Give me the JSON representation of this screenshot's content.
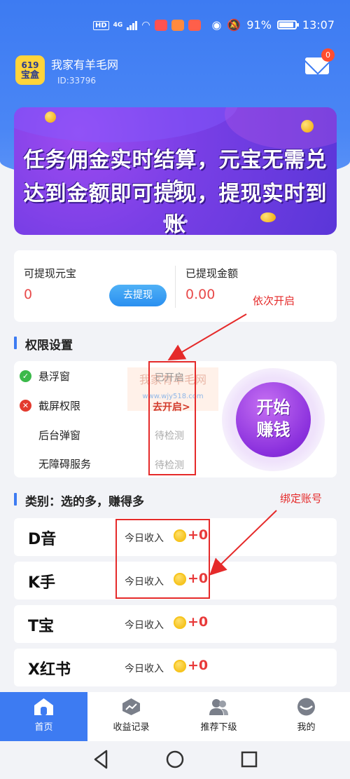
{
  "status_bar": {
    "net": "HD",
    "net2": "4G",
    "battery": "91%",
    "time": "13:07"
  },
  "header": {
    "logo_top": "619",
    "logo_bottom": "宝盒",
    "user_name": "我家有羊毛网",
    "user_id": "ID:33796",
    "message_count": "0"
  },
  "banner": {
    "line1": "任务佣金实时结算，元宝无需兑换",
    "line2": "达到金额即可提现，提现实时到账"
  },
  "withdraw": {
    "available_label": "可提现元宝",
    "available_value": "0",
    "withdraw_button": "去提现",
    "withdrawn_label": "已提现金额",
    "withdrawn_value": "0.00"
  },
  "permissions": {
    "title": "权限设置",
    "items": [
      {
        "name": "悬浮窗",
        "status": "已开启",
        "state": "ok"
      },
      {
        "name": "截屏权限",
        "status": "去开启>",
        "state": "error"
      },
      {
        "name": "后台弹窗",
        "status": "待检测",
        "state": "pending"
      },
      {
        "name": "无障碍服务",
        "status": "待检测",
        "state": "pending"
      }
    ],
    "start_button": {
      "line1": "开始",
      "line2": "赚钱"
    },
    "watermark": {
      "line1": "我家有羊毛网",
      "line2": "www.wjy518.com"
    }
  },
  "annotations": {
    "open_in_order": "依次开启",
    "bind_account": "绑定账号"
  },
  "categories": {
    "title": "类别：选的多，赚得多",
    "items": [
      {
        "name": "D音",
        "income_label": "今日收入",
        "income": "+0"
      },
      {
        "name": "K手",
        "income_label": "今日收入",
        "income": "+0"
      },
      {
        "name": "T宝",
        "income_label": "今日收入",
        "income": "+0"
      },
      {
        "name": "X红书",
        "income_label": "今日收入",
        "income": "+0"
      }
    ]
  },
  "bottom_nav": [
    {
      "label": "首页",
      "icon": "home-icon",
      "active": true
    },
    {
      "label": "收益记录",
      "icon": "chart-icon",
      "active": false
    },
    {
      "label": "推荐下级",
      "icon": "users-icon",
      "active": false
    },
    {
      "label": "我的",
      "icon": "profile-icon",
      "active": false
    }
  ],
  "colors": {
    "primary": "#3d7bf2",
    "accent_red": "#e83a3a",
    "annotation_red": "#e52a2a",
    "banner_purple": "#7a3fe6"
  }
}
